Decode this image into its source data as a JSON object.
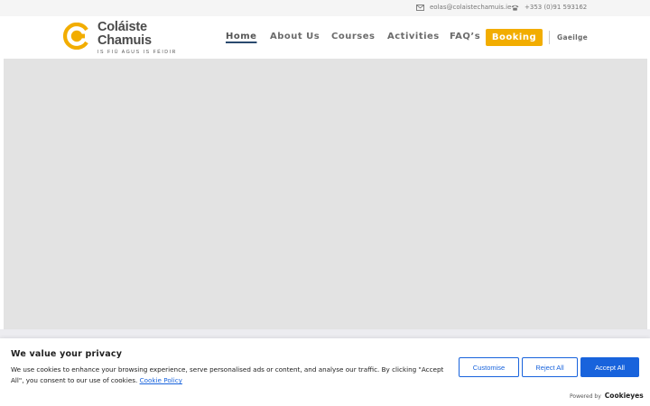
{
  "topbar": {
    "email": "eolas@colaistechamuis.ie",
    "phone": "+353 (0)91 593162"
  },
  "header": {
    "logo": {
      "name": "Coláiste Chamuis",
      "tagline": "IS FIÚ AGUS IS FÉIDIR"
    },
    "nav": {
      "home": "Home",
      "about": "About Us",
      "courses": "Courses",
      "activities": "Activities",
      "faq": "FAQ’s",
      "booking": "Booking",
      "language": "Gaeilge"
    }
  },
  "cookie": {
    "title": "We value your privacy",
    "text": "We use cookies to enhance your browsing experience, serve personalised ads or content, and analyse our traffic. By clicking \"Accept All\", you consent to our use of cookies.",
    "policy_link": "Cookie Policy",
    "customise": "Customise",
    "reject": "Reject All",
    "accept": "Accept All",
    "powered_by": "Powered by",
    "brand": "Cookieyes"
  },
  "colors": {
    "brand_yellow": "#f2ad00",
    "cookie_blue": "#1863dc",
    "hero_bg": "#e3e3e3"
  }
}
